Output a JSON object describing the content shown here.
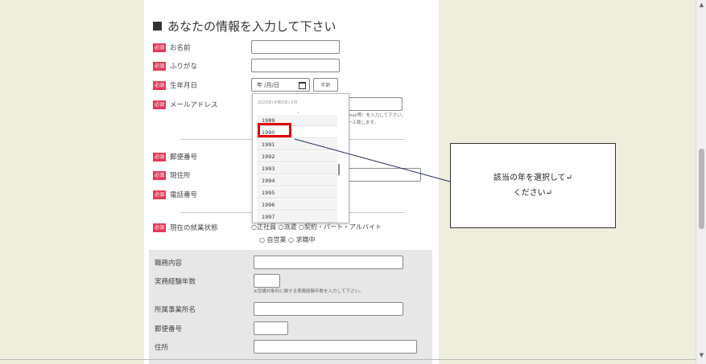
{
  "form": {
    "title": "あなたの情報を入力して下さい",
    "required_badge": "必須",
    "fields": {
      "name": "お名前",
      "furigana": "ふりがな",
      "birthdate": "生年月日",
      "email": "メールアドレス",
      "postal_code": "郵便番号",
      "address": "現住所",
      "phone": "電話番号",
      "employment_status": "現在の就業状態"
    },
    "date_value": "年 /月/日",
    "age_button": "年齢",
    "email_note_1": "mail等）を入力して下さい。",
    "email_note_2": "ール致します。",
    "employment_options_1": "○正社員  ○派遣  ○契約・パート・アルバイト",
    "employment_options_2": "○ 自営業  ○ 求職中",
    "detail": {
      "job_content": "職務内容",
      "experience_years": "実務経験年数",
      "experience_note": "※受講対象科に関する実務経験年数を入力して下さい。",
      "company_name": "所属事業所名",
      "postal_code": "郵便番号",
      "address": "住所"
    }
  },
  "year_picker": {
    "header": "2023年(令和5年) 3月",
    "years": [
      "1989",
      "1990",
      "1991",
      "1992",
      "1993",
      "1994",
      "1995",
      "1996",
      "1997"
    ],
    "selected": "1990"
  },
  "callout": {
    "line1": "該当の年を選択して↵",
    "line2": "ください↵"
  },
  "colors": {
    "required_badge": "#e43a5a",
    "highlight": "#e00000",
    "background": "#efeedd"
  }
}
